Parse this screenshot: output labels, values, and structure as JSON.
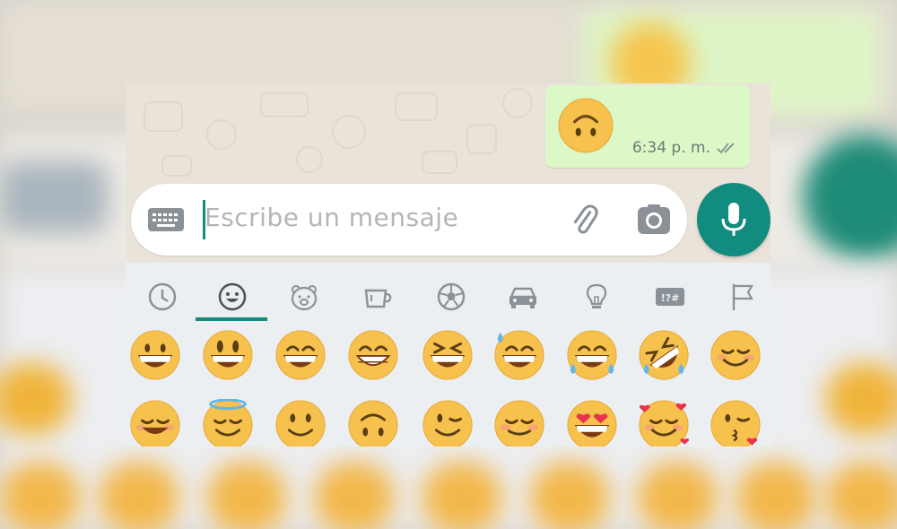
{
  "message": {
    "emoji": "upside-down-face",
    "time": "6:34 p. m.",
    "status": "read-double-check"
  },
  "composer": {
    "placeholder": "Escribe un mensaje",
    "left_icon": "keyboard-icon",
    "attach_icon": "paperclip-icon",
    "camera_icon": "camera-icon",
    "send_icon": "microphone-icon"
  },
  "emoji_tabs": [
    {
      "name": "recent",
      "icon": "clock-icon"
    },
    {
      "name": "smileys",
      "icon": "smiley-icon",
      "selected": true
    },
    {
      "name": "animals",
      "icon": "bear-icon"
    },
    {
      "name": "food",
      "icon": "cup-icon"
    },
    {
      "name": "activity",
      "icon": "soccer-ball-icon"
    },
    {
      "name": "travel",
      "icon": "car-icon"
    },
    {
      "name": "objects",
      "icon": "lightbulb-icon"
    },
    {
      "name": "symbols",
      "icon": "symbols-icon",
      "label": "!?#"
    },
    {
      "name": "flags",
      "icon": "flag-icon"
    }
  ],
  "emoji_grid": [
    [
      "grinning",
      "grinning-big-eyes",
      "grinning-smiling-eyes",
      "beaming",
      "squinting",
      "sweat-smile",
      "tears-of-joy",
      "rolling-laughing",
      "smiling-blush"
    ],
    [
      "smiling-eyes",
      "halo",
      "slight-smile",
      "upside-down",
      "winking",
      "relieved",
      "heart-eyes",
      "smiling-hearts",
      "kissing-heart"
    ]
  ],
  "colors": {
    "accent": "#128c7e",
    "bubble": "#dcf8c6",
    "emoji_yellow": "#f6c24d",
    "panel": "#eceff1",
    "placeholder": "#b2b6b8"
  }
}
